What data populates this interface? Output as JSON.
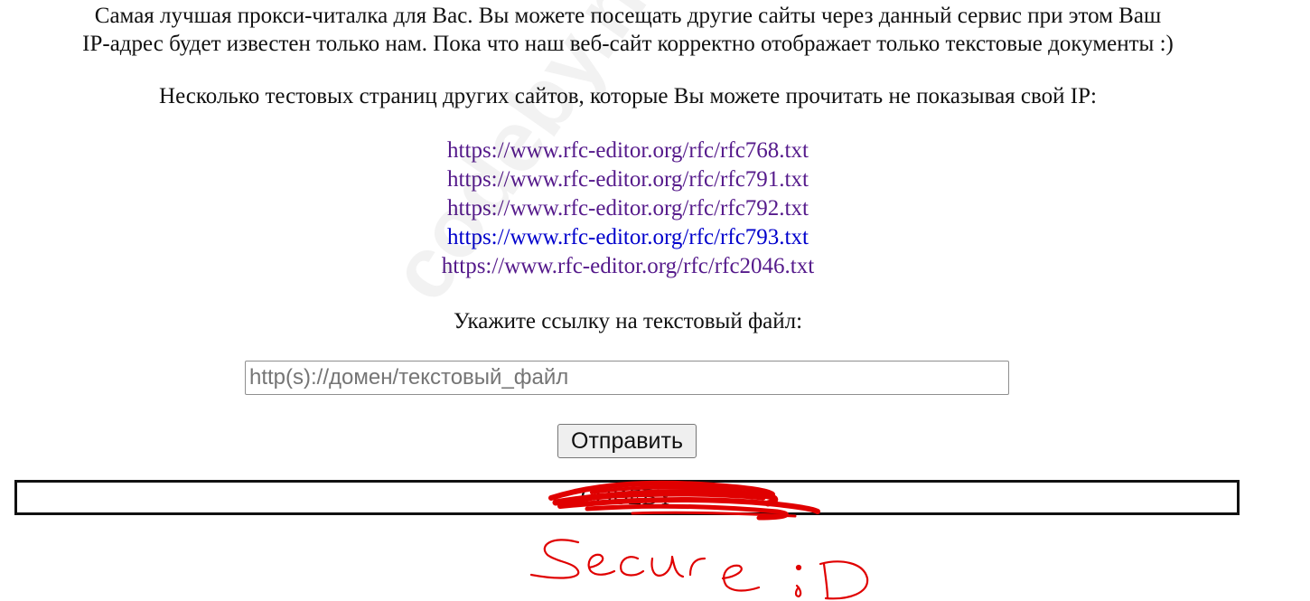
{
  "intro": {
    "line1": "Самая лучшая прокси-читалка для Вас. Вы можете посещать другие сайты через данный сервис при этом Ваш",
    "line2": "IP-адрес будет известен только нам. Пока что наш веб-сайт корректно отображает только текстовые документы :)"
  },
  "links_heading": "Несколько тестовых страниц других сайтов, которые Вы можете прочитать не показывая свой IP:",
  "links": [
    {
      "text": "https://www.rfc-editor.org/rfc/rfc768.txt",
      "color": "#551a8b"
    },
    {
      "text": "https://www.rfc-editor.org/rfc/rfc791.txt",
      "color": "#551a8b"
    },
    {
      "text": "https://www.rfc-editor.org/rfc/rfc792.txt",
      "color": "#551a8b"
    },
    {
      "text": "https://www.rfc-editor.org/rfc/rfc793.txt",
      "color": "#0000cc"
    },
    {
      "text": "https://www.rfc-editor.org/rfc/rfc2046.txt",
      "color": "#551a8b"
    }
  ],
  "form": {
    "prompt": "Укажите ссылку на текстовый файл:",
    "input_placeholder": "http(s)://домен/текстовый_файл",
    "input_value": "",
    "submit_label": "Отправить"
  },
  "footer": {
    "text": "CODEBY"
  },
  "annotation": {
    "text": "Secure :D",
    "color": "#e00000"
  },
  "watermark": {
    "text": "codeby.net"
  }
}
